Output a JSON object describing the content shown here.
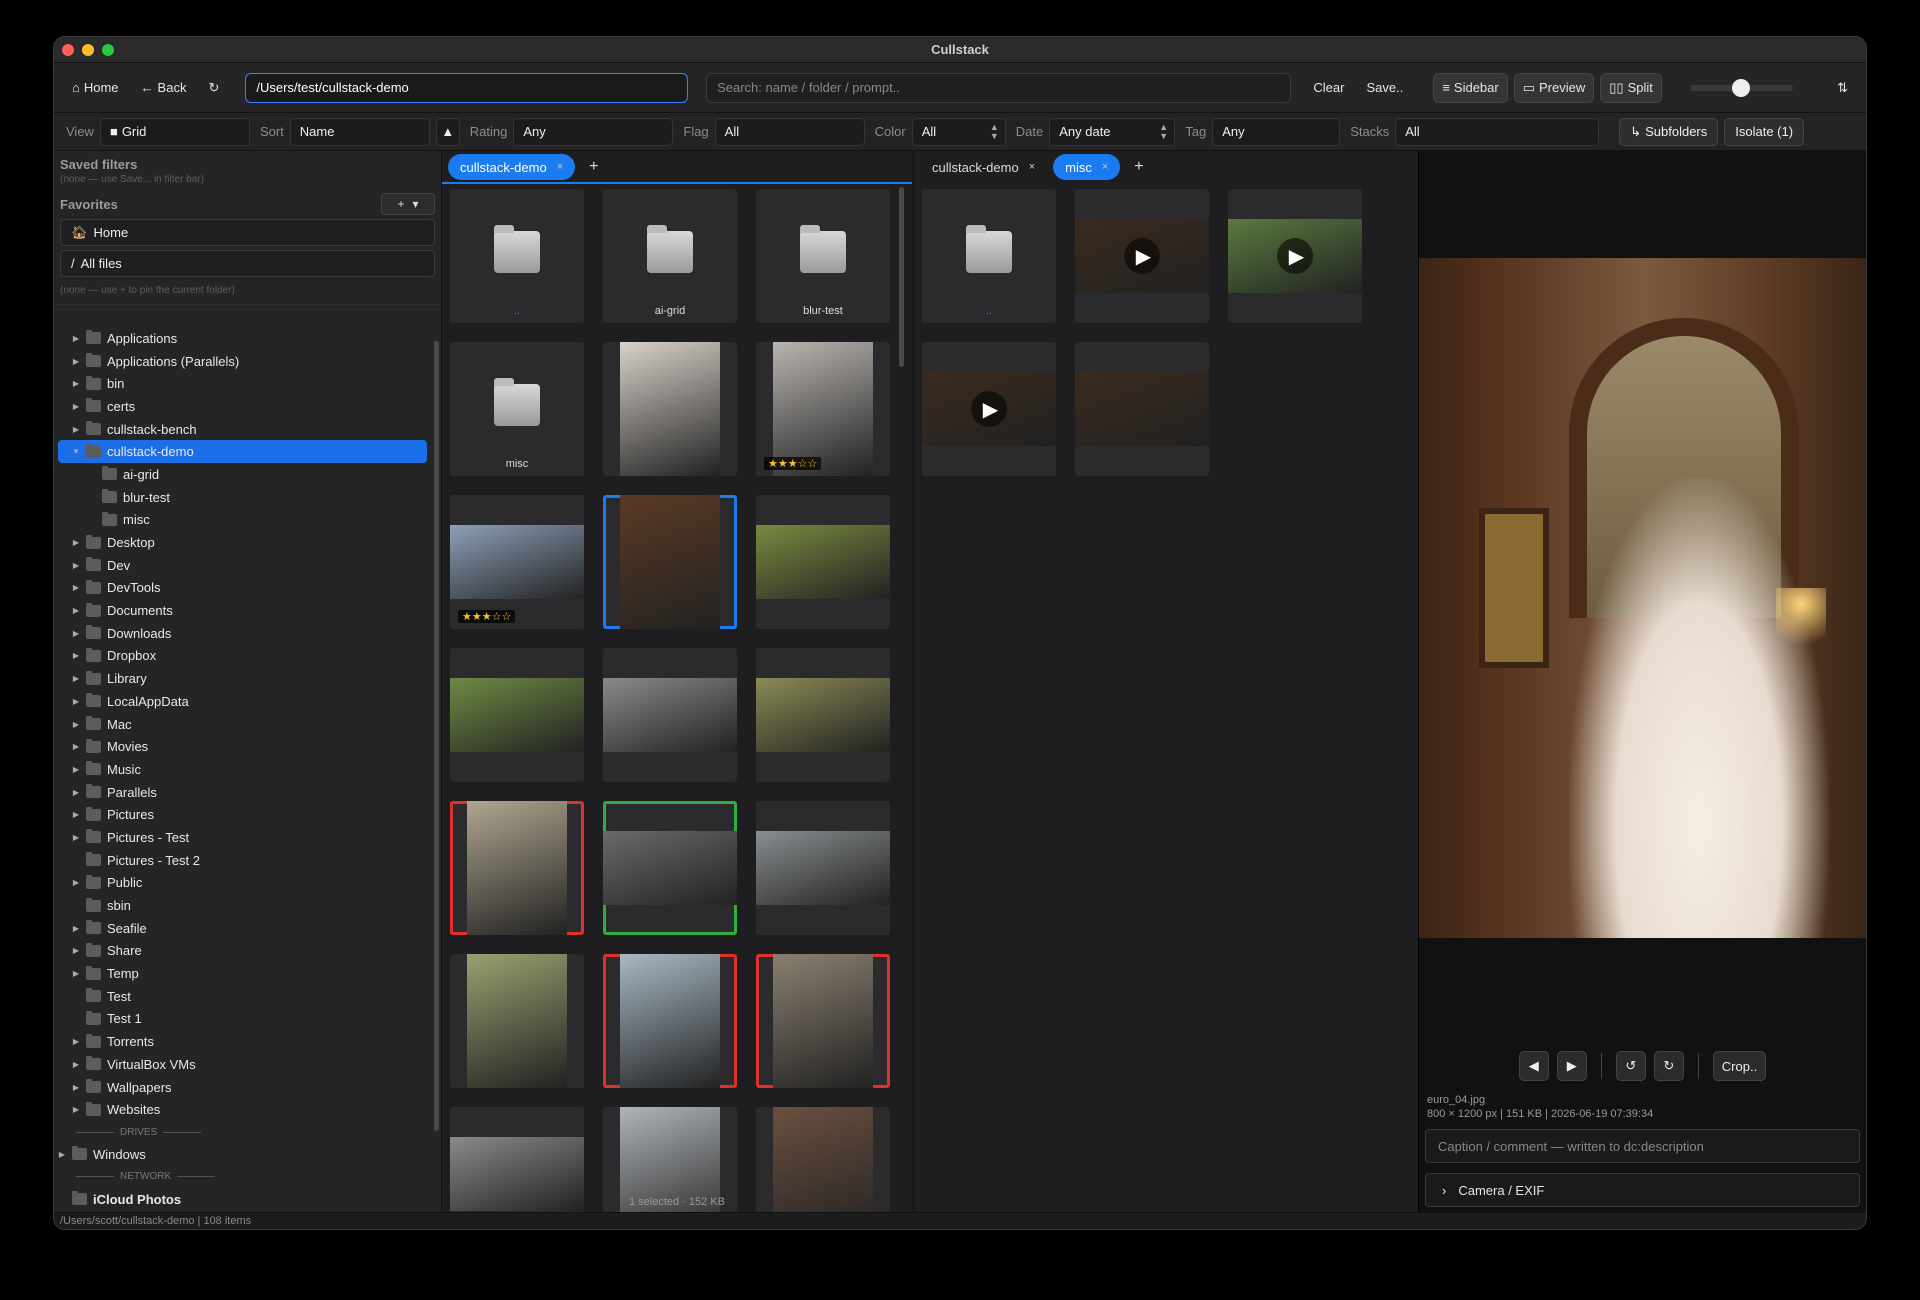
{
  "window": {
    "title": "Cullstack"
  },
  "toolbar": {
    "home": "Home",
    "back": "Back",
    "path": "/Users/test/cullstack-demo",
    "search_placeholder": "Search: name / folder / prompt..",
    "clear": "Clear",
    "save": "Save..",
    "sidebar": "Sidebar",
    "preview": "Preview",
    "split": "Split",
    "thumb_size_level": 0.4
  },
  "filters": {
    "view_label": "View",
    "view_value": "Grid",
    "sort_label": "Sort",
    "sort_value": "Name",
    "rating_label": "Rating",
    "rating_value": "Any",
    "flag_label": "Flag",
    "flag_value": "All",
    "color_label": "Color",
    "color_value": "All",
    "date_label": "Date",
    "date_value": "Any date",
    "tag_label": "Tag",
    "tag_value": "Any",
    "stacks_label": "Stacks",
    "stacks_value": "All",
    "subfolders": "Subfolders",
    "isolate": "Isolate (1)"
  },
  "sidebar": {
    "saved_title": "Saved filters",
    "saved_note": "(none — use Save... in filter bar)",
    "favorites_title": "Favorites",
    "fav_home": "Home",
    "fav_all": "All files",
    "pin_note": "(none — use + to pin the current folder)",
    "drives_label": "DRIVES",
    "drive_windows": "Windows",
    "network_label": "NETWORK",
    "network_icloud": "iCloud Photos",
    "tree": [
      {
        "label": "Applications",
        "caret": true,
        "indent": 0
      },
      {
        "label": "Applications (Parallels)",
        "caret": true,
        "indent": 0
      },
      {
        "label": "bin",
        "caret": true,
        "indent": 0
      },
      {
        "label": "certs",
        "caret": true,
        "indent": 0
      },
      {
        "label": "cullstack-bench",
        "caret": true,
        "indent": 0
      },
      {
        "label": "cullstack-demo",
        "caret": true,
        "indent": 0,
        "selected": true,
        "open": true
      },
      {
        "label": "ai-grid",
        "caret": false,
        "indent": 1
      },
      {
        "label": "blur-test",
        "caret": false,
        "indent": 1
      },
      {
        "label": "misc",
        "caret": false,
        "indent": 1
      },
      {
        "label": "Desktop",
        "caret": true,
        "indent": 0
      },
      {
        "label": "Dev",
        "caret": true,
        "indent": 0
      },
      {
        "label": "DevTools",
        "caret": true,
        "indent": 0
      },
      {
        "label": "Documents",
        "caret": true,
        "indent": 0
      },
      {
        "label": "Downloads",
        "caret": true,
        "indent": 0
      },
      {
        "label": "Dropbox",
        "caret": true,
        "indent": 0
      },
      {
        "label": "Library",
        "caret": true,
        "indent": 0
      },
      {
        "label": "LocalAppData",
        "caret": true,
        "indent": 0
      },
      {
        "label": "Mac",
        "caret": true,
        "indent": 0
      },
      {
        "label": "Movies",
        "caret": true,
        "indent": 0
      },
      {
        "label": "Music",
        "caret": true,
        "indent": 0
      },
      {
        "label": "Parallels",
        "caret": true,
        "indent": 0
      },
      {
        "label": "Pictures",
        "caret": true,
        "indent": 0
      },
      {
        "label": "Pictures - Test",
        "caret": true,
        "indent": 0
      },
      {
        "label": "Pictures - Test 2",
        "caret": false,
        "indent": 0
      },
      {
        "label": "Public",
        "caret": true,
        "indent": 0
      },
      {
        "label": "sbin",
        "caret": false,
        "indent": 0
      },
      {
        "label": "Seafile",
        "caret": true,
        "indent": 0
      },
      {
        "label": "Share",
        "caret": true,
        "indent": 0
      },
      {
        "label": "Temp",
        "caret": true,
        "indent": 0
      },
      {
        "label": "Test",
        "caret": false,
        "indent": 0
      },
      {
        "label": "Test 1",
        "caret": false,
        "indent": 0
      },
      {
        "label": "Torrents",
        "caret": true,
        "indent": 0
      },
      {
        "label": "VirtualBox VMs",
        "caret": true,
        "indent": 0
      },
      {
        "label": "Wallpapers",
        "caret": true,
        "indent": 0
      },
      {
        "label": "Websites",
        "caret": true,
        "indent": 0
      }
    ]
  },
  "left_pane": {
    "tabs": [
      {
        "label": "cullstack-demo",
        "active": true
      }
    ],
    "cells": [
      {
        "type": "folder",
        "caption": ".."
      },
      {
        "type": "folder",
        "caption": "ai-grid"
      },
      {
        "type": "folder",
        "caption": "blur-test"
      },
      {
        "type": "folder",
        "caption": "misc"
      },
      {
        "type": "photo",
        "tone": "#d8d2ca",
        "orient": "portrait"
      },
      {
        "type": "photo",
        "tone": "#b8b4b0",
        "orient": "portrait",
        "stars": "★★★☆☆"
      },
      {
        "type": "photo",
        "tone": "#8ea0b8",
        "orient": "landscape",
        "stars": "★★★☆☆"
      },
      {
        "type": "photo",
        "tone": "#5a3a24",
        "orient": "portrait",
        "mark": "sel"
      },
      {
        "type": "photo",
        "tone": "#7a8a40",
        "orient": "landscape"
      },
      {
        "type": "photo",
        "tone": "#6f8a44",
        "orient": "landscape"
      },
      {
        "type": "photo",
        "tone": "#8a8a8a",
        "orient": "landscape"
      },
      {
        "type": "photo",
        "tone": "#8a8a55",
        "orient": "landscape"
      },
      {
        "type": "photo",
        "tone": "#b0a690",
        "orient": "portrait",
        "mark": "red"
      },
      {
        "type": "photo",
        "tone": "#6a6a6a",
        "orient": "landscape",
        "mark": "green"
      },
      {
        "type": "photo",
        "tone": "#8a8e90",
        "orient": "landscape"
      },
      {
        "type": "photo",
        "tone": "#9aa070",
        "orient": "portrait"
      },
      {
        "type": "photo",
        "tone": "#a8b8c4",
        "orient": "portrait",
        "mark": "red"
      },
      {
        "type": "photo",
        "tone": "#8a8070",
        "orient": "portrait",
        "mark": "red"
      },
      {
        "type": "photo",
        "tone": "#8a8a8a",
        "orient": "landscape"
      },
      {
        "type": "photo",
        "tone": "#b0b4b8",
        "orient": "portrait"
      },
      {
        "type": "photo",
        "tone": "#6a5040",
        "orient": "portrait"
      }
    ],
    "status": "1 selected · 152 KB"
  },
  "right_pane": {
    "tabs": [
      {
        "label": "cullstack-demo",
        "active": false
      },
      {
        "label": "misc",
        "active": true
      }
    ],
    "cells": [
      {
        "type": "folder",
        "caption": ".."
      },
      {
        "type": "video",
        "tone": "#3a2a1e"
      },
      {
        "type": "video",
        "tone": "#5a7a40"
      },
      {
        "type": "video",
        "tone": "#3a2a1e"
      },
      {
        "type": "photo",
        "tone": "#3a2a1e",
        "orient": "landscape"
      }
    ]
  },
  "preview": {
    "filename": "euro_04.jpg",
    "info": "800 × 1200 px | 151 KB | 2026-06-19 07:39:34",
    "caption_placeholder": "Caption / comment — written to dc:description",
    "exif_label": "Camera / EXIF",
    "crop": "Crop.."
  },
  "status": {
    "text": "/Users/scott/cullstack-demo | 108 items"
  },
  "colors": {
    "accent": "#1a7cf0",
    "reject": "#e0302a",
    "pick": "#2fae3f"
  }
}
